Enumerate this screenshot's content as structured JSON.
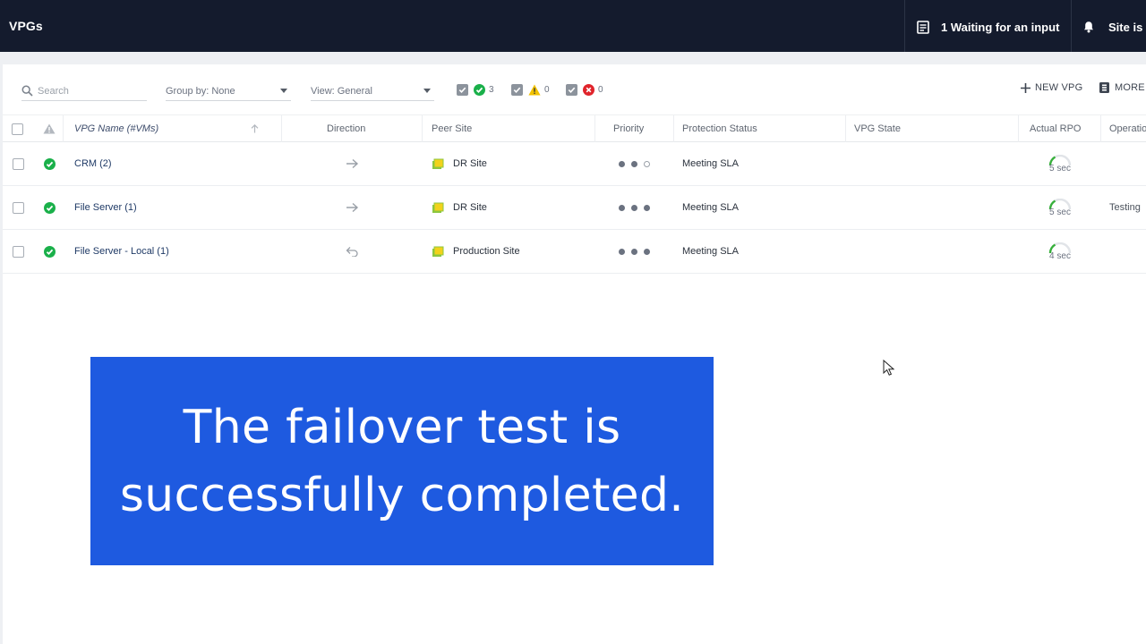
{
  "header": {
    "title": "VPGs",
    "waiting_label": "1 Waiting for an input",
    "site_label": "Site is"
  },
  "toolbar": {
    "search_placeholder": "Search",
    "group_by": "Group by: None",
    "view": "View: General",
    "filters": [
      {
        "status": "ok",
        "count": "3"
      },
      {
        "status": "warning",
        "count": "0"
      },
      {
        "status": "error",
        "count": "0"
      }
    ],
    "new_vpg_label": "NEW VPG",
    "more_label": "MORE"
  },
  "table": {
    "columns": {
      "name": "VPG Name (#VMs)",
      "direction": "Direction",
      "peer_site": "Peer Site",
      "priority": "Priority",
      "protection_status": "Protection Status",
      "vpg_state": "VPG State",
      "actual_rpo": "Actual RPO",
      "operation": "Operatio"
    },
    "rows": [
      {
        "name": "CRM (2)",
        "direction": "outgoing",
        "peer_site": "DR Site",
        "priority": "2 of 3",
        "protection_status": "Meeting SLA",
        "vpg_state": "",
        "actual_rpo": "5 sec",
        "operation": ""
      },
      {
        "name": "File Server (1)",
        "direction": "outgoing",
        "peer_site": "DR Site",
        "priority": "3 of 3",
        "protection_status": "Meeting SLA",
        "vpg_state": "",
        "actual_rpo": "5 sec",
        "operation": "Testing"
      },
      {
        "name": "File Server - Local (1)",
        "direction": "local",
        "peer_site": "Production Site",
        "priority": "3 of 3",
        "protection_status": "Meeting SLA",
        "vpg_state": "",
        "actual_rpo": "4 sec",
        "operation": ""
      }
    ]
  },
  "banner": {
    "text": "The failover test is successfully completed."
  },
  "colors": {
    "topbar": "#141b2d",
    "banner": "#1e5ae0",
    "ok": "#1ab04a",
    "warning": "#f2c200",
    "error": "#e0242b"
  }
}
